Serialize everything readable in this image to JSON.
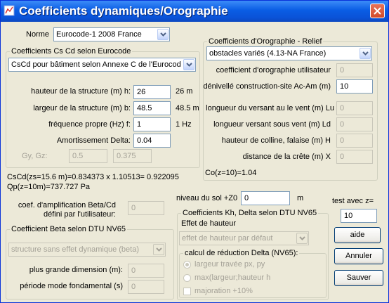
{
  "window": {
    "title": "Coefficients dynamiques/Orographie"
  },
  "norme": {
    "label": "Norme",
    "value": "Eurocode-1 2008 France"
  },
  "cscd": {
    "group_title": "Coefficients Cs Cd selon Eurocode",
    "method": "CsCd pour bâtiment selon Annexe C de l'Eurocode",
    "hauteur": {
      "label": "hauteur de la structure (m) h:",
      "value": "26",
      "unit": "26 m"
    },
    "largeur": {
      "label": "largeur de la structure (m) b:",
      "value": "48.5",
      "unit": "48.5 m"
    },
    "frequence": {
      "label": "fréquence propre (Hz) f:",
      "value": "1",
      "unit": "1 Hz"
    },
    "amortissement": {
      "label": "Amortissement Delta:",
      "value": "0.04"
    },
    "gy_gz": {
      "label": "Gy, Gz:",
      "gy": "0.5",
      "gz": "0.375"
    }
  },
  "orographie": {
    "group_title": "Coefficients d'Orographie - Relief",
    "type": "obstacles variés (4.13-NA France)",
    "coef_utilisateur": {
      "label": "coefficient d'orographie utilisateur",
      "value": "0"
    },
    "denivelle": {
      "label": "dénivellé construction-site Ac-Am (m)",
      "value": "10"
    },
    "longueur_versant_vent": {
      "label": "longueur du versant au le vent (m) Lu",
      "value": "0"
    },
    "longueur_versant_sous_vent": {
      "label": "longueur versant sous vent (m) Ld",
      "value": "0"
    },
    "hauteur_colline": {
      "label": "hauteur de colline, falaise (m) H",
      "value": "0"
    },
    "distance_crete": {
      "label": "distance de la crête (m) X",
      "value": "0"
    },
    "result": "Co(z=10)=1.04"
  },
  "results": {
    "cscd_line": "CsCd(zs=15.6 m)=0.834373 x 1.10513= 0.922095",
    "qp_line": "Qp(z=10m)=737.727 Pa"
  },
  "beta_user": {
    "label_line1": "coef. d'amplification Beta/Cd",
    "label_line2": "défini par l'utilisateur:",
    "value": "0"
  },
  "niveau_sol": {
    "label": "niveau du sol +Z0",
    "value": "0",
    "unit": "m"
  },
  "test_z": {
    "label": "test avec z=",
    "value": "10"
  },
  "beta_nv65": {
    "group_title": "Coefficient Beta selon DTU NV65",
    "type": "structure sans effet dynamique (beta)",
    "dimension": {
      "label": "plus grande dimension (m):",
      "value": "0"
    },
    "periode": {
      "label": "période mode fondamental (s)",
      "value": "0"
    }
  },
  "kh_delta": {
    "group_title": "Coefficients Kh, Delta selon DTU NV65",
    "effet_label": "Effet de hauteur",
    "effet_value": "effet de hauteur par défaut",
    "reduction": {
      "group_title": "calcul de réduction Delta (NV65):",
      "option1": "largeur travée px, py",
      "option2": "max(largeur;hauteur h",
      "majoration": "majoration +10%"
    }
  },
  "buttons": {
    "aide": "aide",
    "annuler": "Annuler",
    "sauver": "Sauver"
  }
}
